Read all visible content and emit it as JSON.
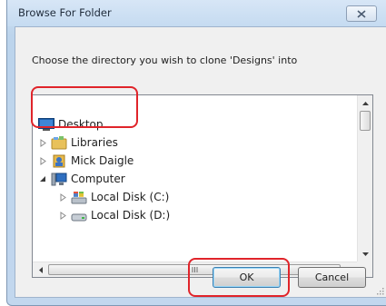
{
  "dialog": {
    "title": "Browse For Folder",
    "prompt": "Choose the directory you wish to clone 'Designs' into"
  },
  "tree": {
    "items": [
      {
        "label": "Desktop",
        "icon": "desktop-icon",
        "expander": "none"
      },
      {
        "label": "Libraries",
        "icon": "libraries-icon",
        "expander": "collapsed"
      },
      {
        "label": "Mick Daigle",
        "icon": "user-folder-icon",
        "expander": "collapsed"
      },
      {
        "label": "Computer",
        "icon": "computer-icon",
        "expander": "expanded"
      },
      {
        "label": "Local Disk (C:)",
        "icon": "system-drive-icon",
        "expander": "collapsed"
      },
      {
        "label": "Local Disk (D:)",
        "icon": "drive-icon",
        "expander": "collapsed"
      }
    ]
  },
  "buttons": {
    "ok": "OK",
    "cancel": "Cancel"
  },
  "colors": {
    "highlight_annotation": "#e0242a",
    "selected_item_bg": "#dceaf8"
  }
}
